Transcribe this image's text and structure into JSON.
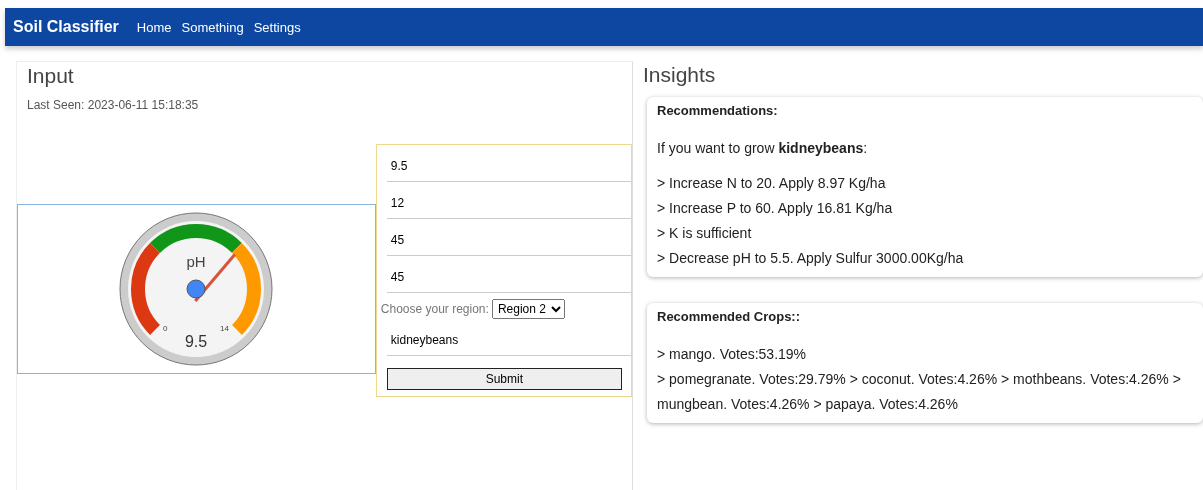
{
  "navbar": {
    "brand": "Soil Classifier",
    "links": [
      "Home",
      "Something",
      "Settings"
    ]
  },
  "input": {
    "title": "Input",
    "last_seen": "Last Seen: 2023-06-11 15:18:35",
    "gauge": {
      "label": "pH",
      "value": "9.5",
      "min": "0",
      "max": "14",
      "level": 0.679
    },
    "fields": [
      "9.5",
      "12",
      "45",
      "45"
    ],
    "region_label": "Choose your region:",
    "region": "Region 2",
    "crop": "kidneybeans",
    "submit": "Submit"
  },
  "insights": {
    "title": "Insights",
    "recommendations": {
      "title": "Recommendations:",
      "intro": "If you want to grow **kidneybeans**:",
      "lines": [
        "> Increase N to 20. Apply 8.97 Kg/ha",
        "> Increase P to 60. Apply 16.81 Kg/ha",
        "> K is sufficient",
        "> Decrease pH to 5.5. Apply Sulfur 3000.00Kg/ha"
      ]
    },
    "crops": {
      "title": "Recommended Crops::",
      "lines": [
        "> mango. Votes:53.19%",
        "> pomegranate. Votes:29.79% > coconut. Votes:4.26% > mothbeans. Votes:4.26% > mungbean. Votes:4.26% > papaya. Votes:4.26%"
      ]
    }
  }
}
